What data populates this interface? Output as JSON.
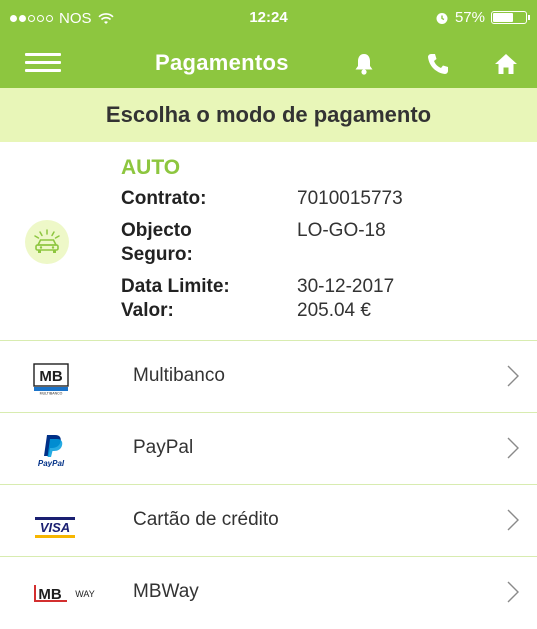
{
  "status": {
    "carrier": "NOS",
    "time": "12:24",
    "battery": "57%"
  },
  "nav": {
    "title": "Pagamentos"
  },
  "subheader": "Escolha o modo de pagamento",
  "policy": {
    "type": "AUTO",
    "contrato_label": "Contrato:",
    "contrato_value": "7010015773",
    "objecto_label_1": "Objecto",
    "objecto_label_2": "Seguro:",
    "objecto_value": "LO-GO-18",
    "data_label": "Data Limite:",
    "data_value": "30-12-2017",
    "valor_label": "Valor:",
    "valor_value": "205.04 €"
  },
  "payment_methods": [
    {
      "label": "Multibanco",
      "logo": "MB"
    },
    {
      "label": "PayPal",
      "logo": "PayPal"
    },
    {
      "label": "Cartão de crédito",
      "logo": "VISA"
    },
    {
      "label": "MBWay",
      "logo": "MB WAY"
    }
  ],
  "colors": {
    "brand_green": "#8dc63f",
    "light_green": "#e8f6b8"
  }
}
